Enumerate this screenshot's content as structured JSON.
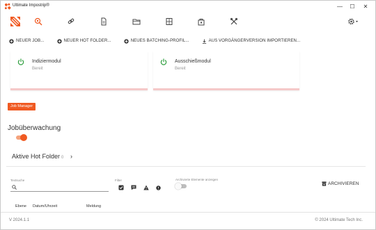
{
  "window": {
    "title": "Ultimate Impostrip®",
    "minimize": "—",
    "maximize": "☐",
    "close": "✕"
  },
  "toolbar": {
    "icons": [
      "logo-icon",
      "search-job-icon",
      "link-icon",
      "document-icon",
      "folder-icon",
      "layout-icon",
      "lock-box-icon",
      "tools-icon",
      "settings-icon"
    ]
  },
  "actions": {
    "new_job": "NEUER JOB...",
    "new_hot_folder": "NEUER HOT FOLDER...",
    "new_batching_profile": "NEUES BATCHING-PROFIL...",
    "import_previous": "AUS VORGÄNGERVERSION IMPORTIEREN..."
  },
  "modules": [
    {
      "name": "Indiziermodul",
      "state": "Bereit"
    },
    {
      "name": "Ausschießmodul",
      "state": "Bereit"
    }
  ],
  "job_manager_label": "Job Manager",
  "job_monitoring": {
    "title": "Jobüberwachung"
  },
  "hot_folders": {
    "title": "Aktive Hot Folder",
    "count": "0",
    "chevron": "›"
  },
  "filters": {
    "search_label": "Textsuche",
    "filter_label": "Filter",
    "show_archived_label": "Archivierte Elemente anzeigen",
    "archive_label": "ARCHIVIEREN"
  },
  "columns": [
    "Ebene",
    "Datum/Uhrzeit",
    "Meldung"
  ],
  "footer": {
    "version": "V 2024.1.1",
    "copyright": "© 2024 Ultimate Tech Inc."
  },
  "colors": {
    "accent": "#f05a22",
    "power_green": "#2e9e3e",
    "progress_bg": "#f5c9c9"
  }
}
